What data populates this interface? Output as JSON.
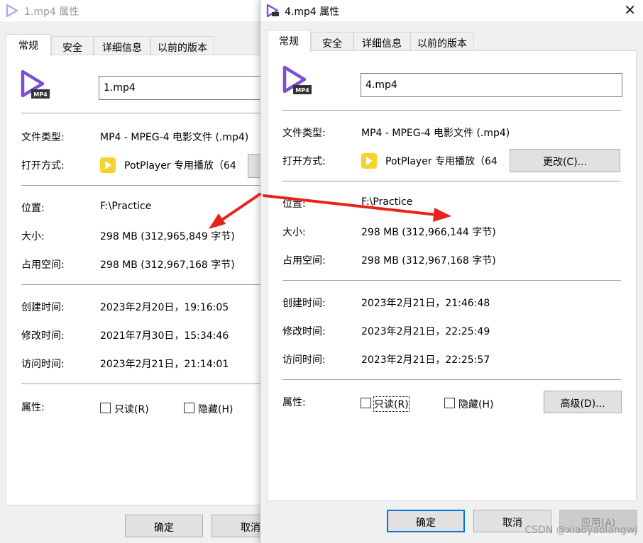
{
  "back_window": {
    "title": "1.mp4 属性",
    "tabs": [
      "常规",
      "安全",
      "详细信息",
      "以前的版本"
    ],
    "file_name": "1.mp4",
    "labels": {
      "file_type": "文件类型:",
      "opens_with": "打开方式:",
      "location": "位置:",
      "size": "大小:",
      "size_on_disk": "占用空间:",
      "created": "创建时间:",
      "modified": "修改时间:",
      "accessed": "访问时间:",
      "attributes": "属性:"
    },
    "values": {
      "file_type": "MP4 - MPEG-4 电影文件 (.mp4)",
      "opens_with": "PotPlayer 专用播放（64",
      "location": "F:\\Practice",
      "size": "298 MB (312,965,849 字节)",
      "size_on_disk": "298 MB (312,967,168 字节)",
      "created": "2023年2月20日，19:16:05",
      "modified": "2021年7月30日，15:34:46",
      "accessed": "2023年2月21日，21:14:01"
    },
    "readonly_label": "只读(R)",
    "hidden_label": "隐藏(H)",
    "ok_label": "确定",
    "cancel_label": "取消"
  },
  "front_window": {
    "title": "4.mp4 属性",
    "close": "✕",
    "tabs": [
      "常规",
      "安全",
      "详细信息",
      "以前的版本"
    ],
    "file_name": "4.mp4",
    "labels": {
      "file_type": "文件类型:",
      "opens_with": "打开方式:",
      "location": "位置:",
      "size": "大小:",
      "size_on_disk": "占用空间:",
      "created": "创建时间:",
      "modified": "修改时间:",
      "accessed": "访问时间:",
      "attributes": "属性:"
    },
    "values": {
      "file_type": "MP4 - MPEG-4 电影文件 (.mp4)",
      "opens_with": "PotPlayer 专用播放（64",
      "location": "F:\\Practice",
      "size": "298 MB (312,966,144 字节)",
      "size_on_disk": "298 MB (312,967,168 字节)",
      "created": "2023年2月21日，21:46:48",
      "modified": "2023年2月21日，22:25:49",
      "accessed": "2023年2月21日，22:25:57"
    },
    "change_label": "更改(C)...",
    "readonly_label": "只读(R)",
    "hidden_label": "隐藏(H)",
    "advanced_label": "高级(D)...",
    "ok_label": "确定",
    "cancel_label": "取消",
    "apply_label": "应用(A)"
  },
  "watermark": "CSDN @xiaoyaolangwj",
  "colors": {
    "annotation_arrow": "#e8231b",
    "app_icon": "#7b4fd6",
    "potplayer": "#f7d22c",
    "primary_border": "#0078d7"
  }
}
